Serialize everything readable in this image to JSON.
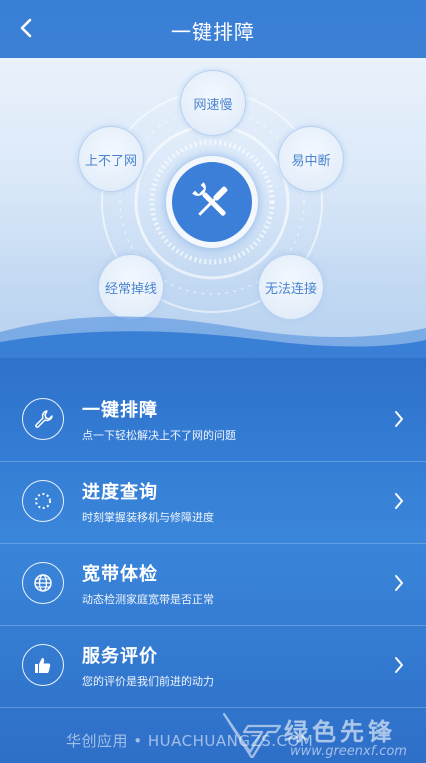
{
  "header": {
    "title": "一键排障"
  },
  "hero": {
    "bubbles": {
      "top": "网速慢",
      "left": "上不了网",
      "right": "易中断",
      "bottom_left": "经常掉线",
      "bottom_right": "无法连接"
    }
  },
  "menu": [
    {
      "title": "一键排障",
      "subtitle": "点一下轻松解决上不了网的问题",
      "icon": "wrench-icon"
    },
    {
      "title": "进度查询",
      "subtitle": "时刻掌握装移机与修障进度",
      "icon": "progress-icon"
    },
    {
      "title": "宽带体检",
      "subtitle": "动态检测家庭宽带是否正常",
      "icon": "globe-icon"
    },
    {
      "title": "服务评价",
      "subtitle": "您的评价是我们前进的动力",
      "icon": "thumbs-up-icon"
    }
  ],
  "footer": {
    "text": "华创应用 • HUACHUANGZS.COM",
    "watermark_brand": "绿色先锋",
    "watermark_url": "www.greenxf.com"
  },
  "colors": {
    "primary": "#3a7fd6",
    "hero_bg": "#dbe8f8",
    "text_light": "#ffffff"
  }
}
